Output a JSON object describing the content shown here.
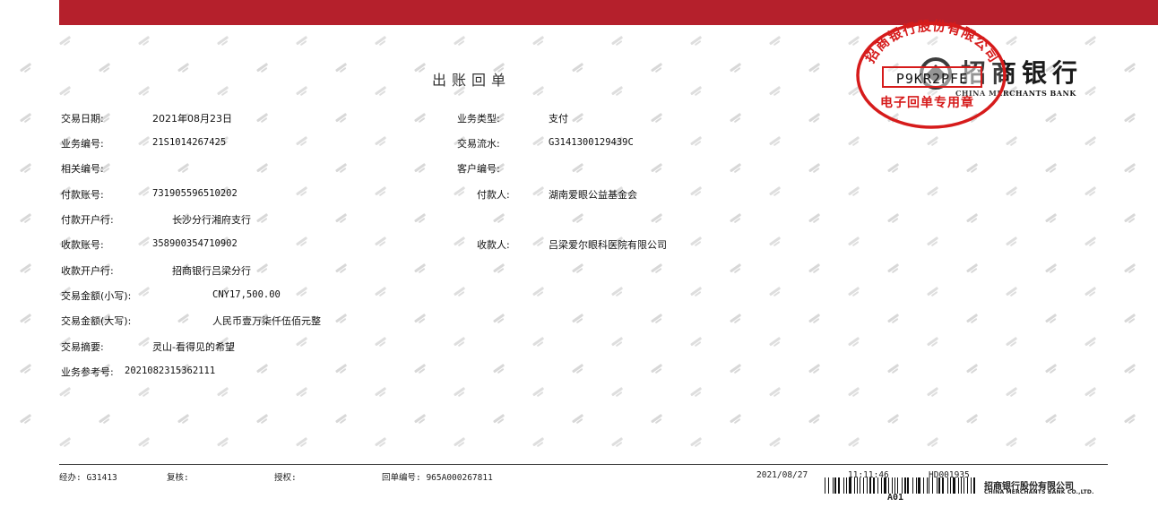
{
  "colors": {
    "brand_red": "#b5202c",
    "seal_red": "#d61b1b"
  },
  "header": {
    "title": "出账回单",
    "bank_name_cn": "招商银行",
    "bank_name_en": "CHINA MERCHANTS BANK"
  },
  "seal": {
    "company_arc": "招商银行股份有限公司",
    "code": "P9KR2PFE",
    "label": "电子回单专用章"
  },
  "fields": {
    "trade_date_label": "交易日期:",
    "trade_date": "2021年08月23日",
    "biz_type_label": "业务类型:",
    "biz_type": "支付",
    "biz_no_label": "业务编号:",
    "biz_no": "21S1014267425",
    "serial_label": "交易流水:",
    "serial": "G3141300129439C",
    "related_no_label": "相关编号:",
    "customer_no_label": "客户编号:",
    "payer_account_label": "付款账号:",
    "payer_account": "731905596510202",
    "payer_label": "付款人:",
    "payer": "湖南爱眼公益基金会",
    "payer_bank_label": "付款开户行:",
    "payer_bank": "长沙分行湘府支行",
    "payee_account_label": "收款账号:",
    "payee_account": "358900354710902",
    "payee_label": "收款人:",
    "payee": "吕梁爱尔眼科医院有限公司",
    "payee_bank_label": "收款开户行:",
    "payee_bank": "招商银行吕梁分行",
    "amount_small_label": "交易金额(小写):",
    "amount_small": "CNY17,500.00",
    "amount_big_label": "交易金额(大写):",
    "amount_big": "人民币壹万柒仟伍佰元整",
    "summary_label": "交易摘要:",
    "summary": "灵山-看得见的希望",
    "ref_no_label": "业务参考号:",
    "ref_no": "2021082315362111"
  },
  "footer": {
    "handler": "经办: G31413",
    "review": "复核:",
    "authorize": "授权:",
    "receipt_no": "回单编号: 965A000267811",
    "date": "2021/08/27",
    "time": "11:11:46",
    "code": "HD001935",
    "a01": "A01",
    "bank_cn": "招商银行股份有限公司",
    "bank_en": "CHINA MERCHANTS BANK CO.,LTD."
  }
}
